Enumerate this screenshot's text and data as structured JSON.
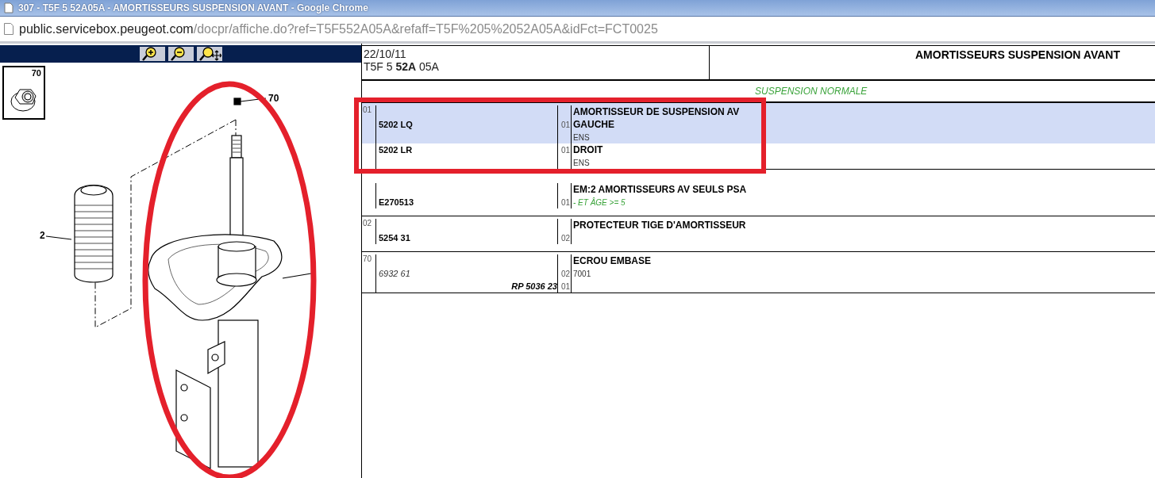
{
  "window": {
    "title": "307 - T5F 5 52A05A - AMORTISSEURS SUSPENSION AVANT - Google Chrome"
  },
  "address_bar": {
    "host": "public.servicebox.peugeot.com",
    "path": "/docpr/affiche.do?ref=T5F552A05A&refaff=T5F%205%2052A05A&idFct=FCT0025"
  },
  "viewer": {
    "tools": [
      {
        "kind": "zoom-in"
      },
      {
        "kind": "zoom-out"
      },
      {
        "kind": "zoom-pan"
      }
    ],
    "thumbnail": {
      "label": "70"
    },
    "callouts": [
      {
        "label": "70"
      },
      {
        "label": "2"
      }
    ]
  },
  "sheet": {
    "date": "22/10/11",
    "reference": "T5F 5 **52A** 05A",
    "title": "AMORTISSEURS SUSPENSION AVANT",
    "section": "SUSPENSION NORMALE",
    "groups": [
      {
        "index": "01",
        "blocks": [
          {
            "selected": true,
            "lines": [
              {
                "desc": {
                  "text": "AMORTISSEUR DE SUSPENSION AV",
                  "kind": "title"
                }
              },
              {
                "part": {
                  "text": "5202 LQ",
                  "kind": "main"
                },
                "qty": "01",
                "desc": {
                  "text": "GAUCHE",
                  "kind": "title"
                }
              },
              {
                "desc": {
                  "text": "ENS",
                  "kind": "note"
                }
              }
            ]
          },
          {
            "selected": false,
            "lines": [
              {
                "part": {
                  "text": "5202 LR",
                  "kind": "main"
                },
                "qty": "01",
                "desc": {
                  "text": "DROIT",
                  "kind": "title"
                }
              },
              {
                "desc": {
                  "text": "ENS",
                  "kind": "note"
                }
              }
            ]
          }
        ]
      },
      {
        "blocks": [
          {
            "selected": false,
            "lines": [
              {
                "desc": {
                  "text": "EM:2 AMORTISSEURS AV SEULS PSA",
                  "kind": "title"
                }
              },
              {
                "part": {
                  "text": "E270513",
                  "kind": "main"
                },
                "qty": "01",
                "desc": {
                  "text": "- ET ÂGE >= 5",
                  "kind": "condition"
                }
              }
            ]
          }
        ]
      },
      {
        "index": "02",
        "blocks": [
          {
            "selected": false,
            "lines": [
              {
                "desc": {
                  "text": "PROTECTEUR TIGE D'AMORTISSEUR",
                  "kind": "title"
                }
              },
              {
                "part": {
                  "text": "5254 31",
                  "kind": "main"
                },
                "qty": "02"
              }
            ]
          }
        ]
      },
      {
        "index": "70",
        "blocks": [
          {
            "selected": false,
            "lines": [
              {
                "desc": {
                  "text": "ECROU EMBASE",
                  "kind": "title"
                }
              },
              {
                "part": {
                  "text": "6932 61",
                  "kind": "alternate"
                },
                "qty": "02",
                "desc": {
                  "text": "7001",
                  "kind": "note"
                }
              },
              {
                "part": {
                  "text": "RP 5036 23",
                  "kind": "replacement"
                },
                "qty": "01"
              }
            ]
          }
        ]
      }
    ]
  }
}
